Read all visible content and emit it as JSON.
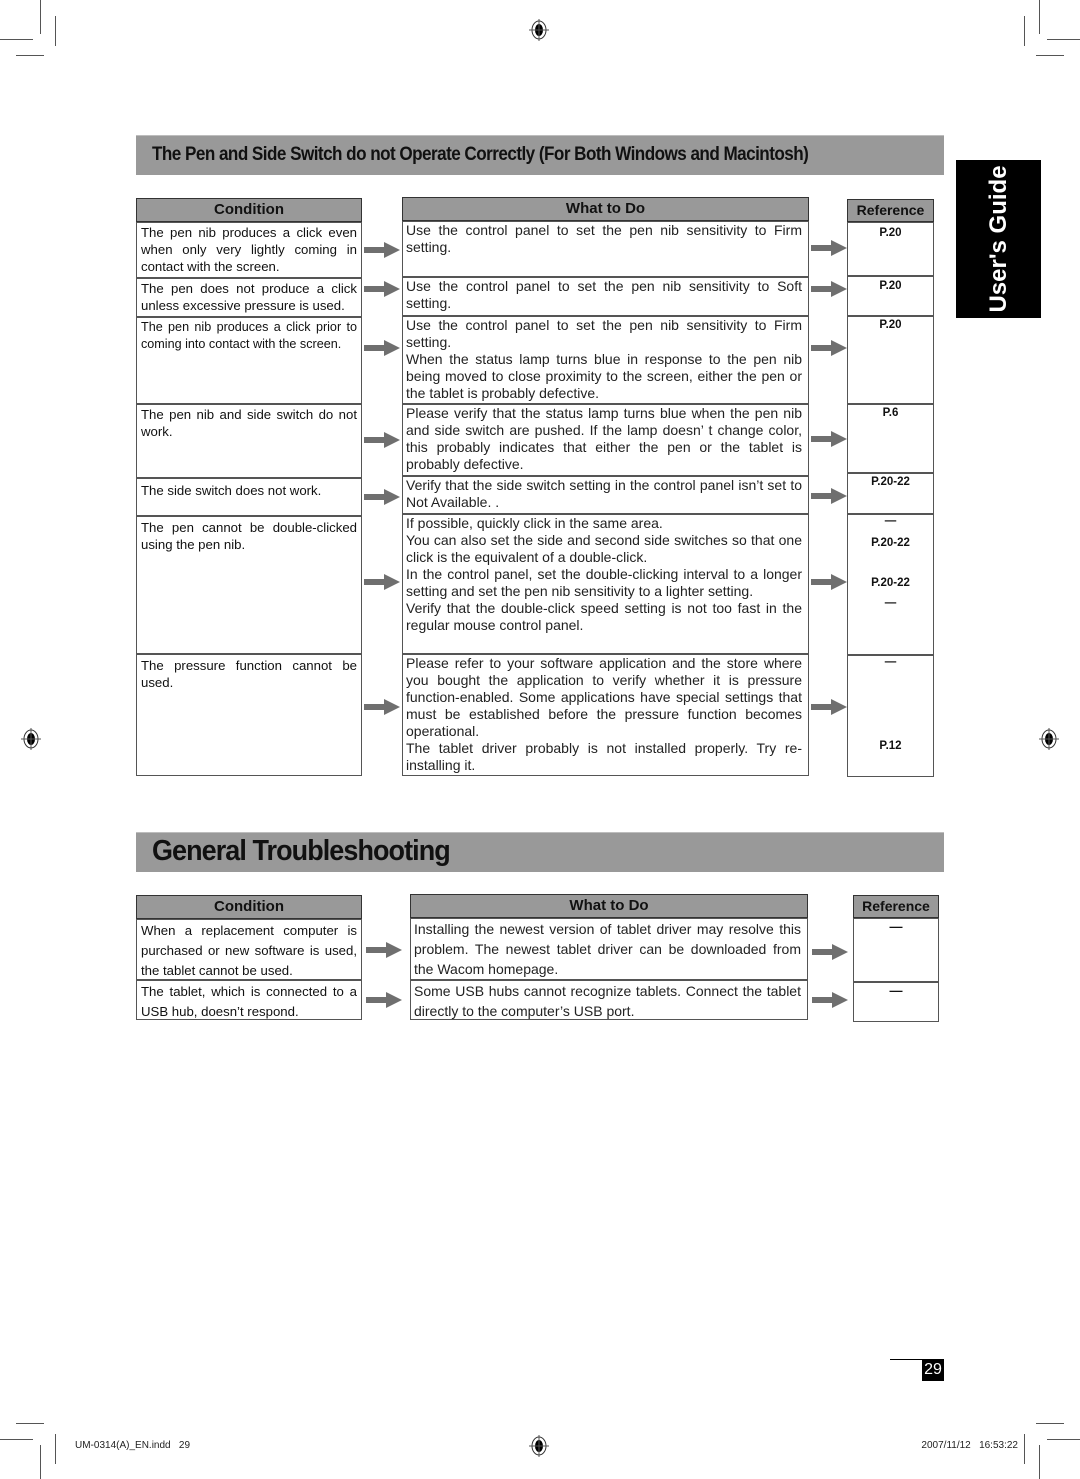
{
  "section1": {
    "title": "The Pen and Side Switch do not Operate Correctly (For Both Windows and Macintosh)",
    "headers": {
      "condition": "Condition",
      "what_to_do": "What to Do",
      "reference": "Reference"
    },
    "rows": [
      {
        "condition": "The pen nib produces a click even when only very lightly coming in contact with the screen.",
        "what_to_do": [
          "Use the control panel to set the pen nib sensitivity to Firm setting."
        ],
        "reference": [
          "P.20"
        ]
      },
      {
        "condition": "The pen does not produce a click unless excessive pressure is used.",
        "what_to_do": [
          "Use the control panel to set the pen nib sensitivity to Soft setting."
        ],
        "reference": [
          "P.20"
        ]
      },
      {
        "condition": "The pen nib produces a click prior to coming into contact with the screen.",
        "what_to_do": [
          "Use the control panel to set the pen nib sensitivity to Firm setting.",
          "When the status lamp turns blue in response to the pen nib being moved to close proximity to the screen, either the pen or the tablet is probably defective."
        ],
        "reference": [
          "P.20"
        ]
      },
      {
        "condition": "The pen nib and side switch do not work.",
        "what_to_do": [
          "Please verify that the status lamp turns blue when the pen nib and side switch are pushed. If the lamp doesn’ t change color, this probably indicates that either the pen or the tablet is probably defective."
        ],
        "reference": [
          "P.6"
        ]
      },
      {
        "condition": "The side switch does not work.",
        "what_to_do": [
          "Verify that the side switch setting in the control panel isn’t set to Not Available. ."
        ],
        "reference": [
          "P.20-22"
        ]
      },
      {
        "condition": "The pen cannot be double-clicked using the pen nib.",
        "what_to_do": [
          "If possible, quickly click in the same area.",
          "You can also set the side and second side switches so that one click is the equivalent of a double-click.",
          "In the control panel, set the double-clicking interval to a longer setting and set the pen nib sensitivity to a lighter setting.",
          "Verify that the double-click speed setting is not too fast in the regular mouse control panel."
        ],
        "reference": [
          "—",
          "P.20-22",
          "P.20-22",
          "—"
        ]
      },
      {
        "condition": "The pressure function cannot be used.",
        "what_to_do": [
          "Please refer to your software application and the store where you bought the application to verify whether it is pressure function-enabled. Some applications have special settings that must be established before the pressure function becomes operational.",
          "The tablet driver probably is not installed properly. Try re-installing it."
        ],
        "reference": [
          "—",
          "P.12"
        ]
      }
    ]
  },
  "section2": {
    "title": "General Troubleshooting",
    "headers": {
      "condition": "Condition",
      "what_to_do": "What to Do",
      "reference": "Reference"
    },
    "rows": [
      {
        "condition": "When a replacement computer is purchased or new software is used, the tablet cannot be used.",
        "what_to_do": [
          "Installing the newest version of tablet driver may resolve this problem. The newest tablet driver can be downloaded from the Wacom homepage."
        ],
        "reference": [
          "—"
        ]
      },
      {
        "condition": "The tablet, which is connected to a USB hub, doesn’t respond.",
        "what_to_do": [
          "Some USB hubs cannot recognize tablets. Connect the tablet directly to the computer’s USB port."
        ],
        "reference": [
          "—"
        ]
      }
    ]
  },
  "side_tab": "User's Guide",
  "page_number": "29",
  "footer": {
    "file": "UM-0314(A)_EN.indd   29",
    "timestamp": "2007/11/12   16:53:22"
  },
  "icons": {
    "arrow": "right-arrow-icon",
    "registration": "registration-mark-icon"
  }
}
